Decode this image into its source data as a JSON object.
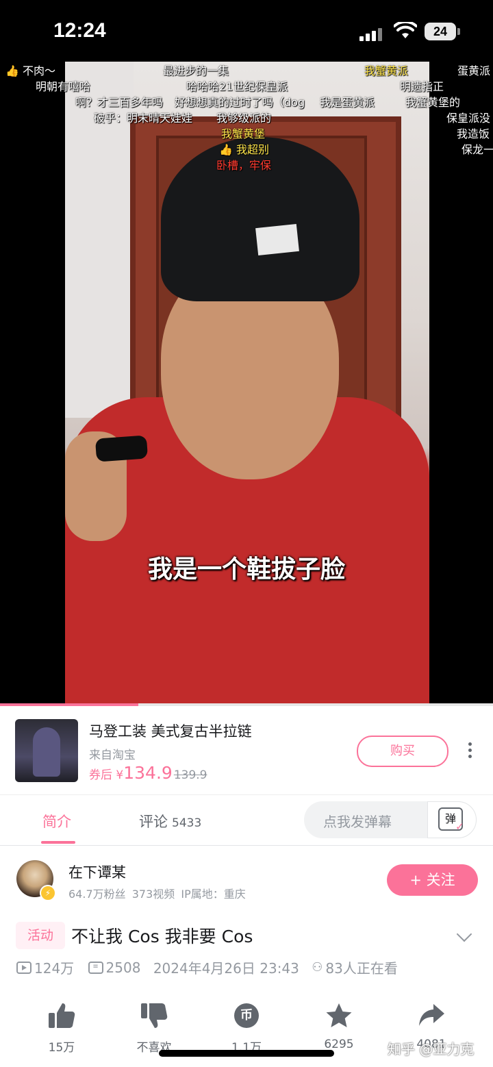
{
  "status_bar": {
    "time": "12:24",
    "battery": "24"
  },
  "video": {
    "subtitle": "我是一个鞋拔子脸",
    "progress": 0.28,
    "danmaku": [
      {
        "text": "👍 不肉～",
        "color": "white"
      },
      {
        "text": "最进步的一集",
        "color": "white"
      },
      {
        "text": "我蟹黄派",
        "color": "yellow"
      },
      {
        "text": "蛋黄派",
        "color": "white"
      },
      {
        "text": "明朝有嘻哈",
        "color": "white"
      },
      {
        "text": "哈哈哈21世纪保皇派",
        "color": "white"
      },
      {
        "text": "明遗指正",
        "color": "white"
      },
      {
        "text": "啊？才三百多年吗",
        "color": "white"
      },
      {
        "text": "好想想真的过时了吗（dog",
        "color": "white"
      },
      {
        "text": "我是蛋黄派",
        "color": "white"
      },
      {
        "text": "我蟹黄堡的",
        "color": "white"
      },
      {
        "text": "破乎：明末晴天娃娃",
        "color": "white"
      },
      {
        "text": "我够级派的",
        "color": "white"
      },
      {
        "text": "保皇派没",
        "color": "white"
      },
      {
        "text": "我蟹黄堡",
        "color": "yellow"
      },
      {
        "text": "我造饭",
        "color": "white"
      },
      {
        "text": "👍 我超别",
        "color": "yellow"
      },
      {
        "text": "保龙一",
        "color": "white"
      },
      {
        "text": "卧槽，牢保",
        "color": "red"
      }
    ]
  },
  "ad": {
    "title": "马登工装 美式复古半拉链",
    "source": "来自淘宝",
    "price_label": "券后 ¥",
    "price": "134.9",
    "original_price": "139.9",
    "buy_label": "购买"
  },
  "tabs": {
    "intro": "简介",
    "comments": "评论",
    "comments_count": "5433",
    "danmaku_placeholder": "点我发弹幕",
    "danmaku_icon_text": "弹"
  },
  "uploader": {
    "name": "在下谭某",
    "fans": "64.7万粉丝",
    "videos": "373视频",
    "ip": "IP属地：重庆",
    "follow_label": "+ 关注"
  },
  "video_info": {
    "tag": "活动",
    "title": "不让我 Cos 我非要 Cos",
    "plays": "124万",
    "danmaku_count": "2508",
    "date": "2024年4月26日 23:43",
    "watching": "83人正在看"
  },
  "actions": [
    {
      "icon": "thumbs-up-icon",
      "label": "15万"
    },
    {
      "icon": "thumbs-down-icon",
      "label": "不喜欢"
    },
    {
      "icon": "coin-icon",
      "label": "1.1万",
      "glyph": "币"
    },
    {
      "icon": "star-icon",
      "label": "6295"
    },
    {
      "icon": "share-icon",
      "label": "4081"
    }
  ],
  "watermark": "知乎 @亚力克",
  "colors": {
    "accent": "#fb7299",
    "muted": "#9499a0"
  }
}
